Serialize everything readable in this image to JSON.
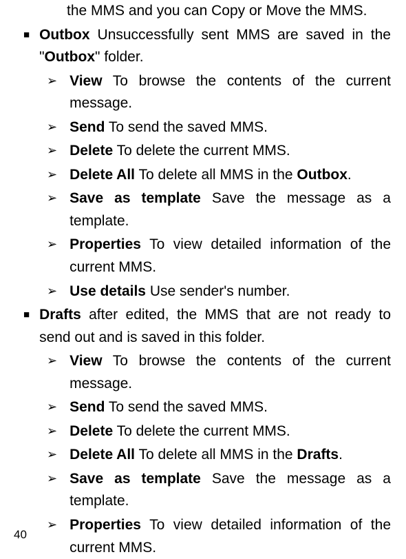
{
  "pageNumber": "40",
  "continuation": "the MMS and you can Copy or Move the MMS.",
  "items": [
    {
      "name": "outbox",
      "title": "Outbox",
      "pre": " Unsuccessfully sent MMS are saved in the \"",
      "emph": "Outbox",
      "post": "\" folder.",
      "sub": [
        {
          "name": "outbox-view",
          "t": "View",
          "d": " To browse the contents of the current message."
        },
        {
          "name": "outbox-send",
          "t": "Send",
          "d": " To send the saved MMS."
        },
        {
          "name": "outbox-delete",
          "t": "Delete",
          "d": " To delete the current MMS."
        },
        {
          "name": "outbox-delete-all",
          "t": "Delete All",
          "d_pre": " To delete all MMS in the ",
          "d_bold": "Outbox",
          "d_post": "."
        },
        {
          "name": "outbox-save-template",
          "t": "Save as template",
          "d": " Save the message as a template."
        },
        {
          "name": "outbox-properties",
          "t": "Properties",
          "d": " To view detailed information of the current MMS."
        },
        {
          "name": "outbox-use-details",
          "t": "Use details",
          "d": " Use sender's number."
        }
      ]
    },
    {
      "name": "drafts",
      "title": "Drafts",
      "post": " after edited, the MMS that are not ready to send out and is saved in this folder.",
      "sub": [
        {
          "name": "drafts-view",
          "t": "View",
          "d": " To browse the contents of the current message."
        },
        {
          "name": "drafts-send",
          "t": "Send",
          "d": " To send the saved MMS."
        },
        {
          "name": "drafts-delete",
          "t": "Delete",
          "d": " To delete the current MMS."
        },
        {
          "name": "drafts-delete-all",
          "t": "Delete All",
          "d_pre": " To delete all MMS in the ",
          "d_bold": "Drafts",
          "d_post": "."
        },
        {
          "name": "drafts-save-template",
          "t": "Save as template",
          "d": " Save the message as a template."
        },
        {
          "name": "drafts-properties",
          "t": "Properties",
          "d": " To view detailed information of the current MMS."
        }
      ]
    }
  ]
}
